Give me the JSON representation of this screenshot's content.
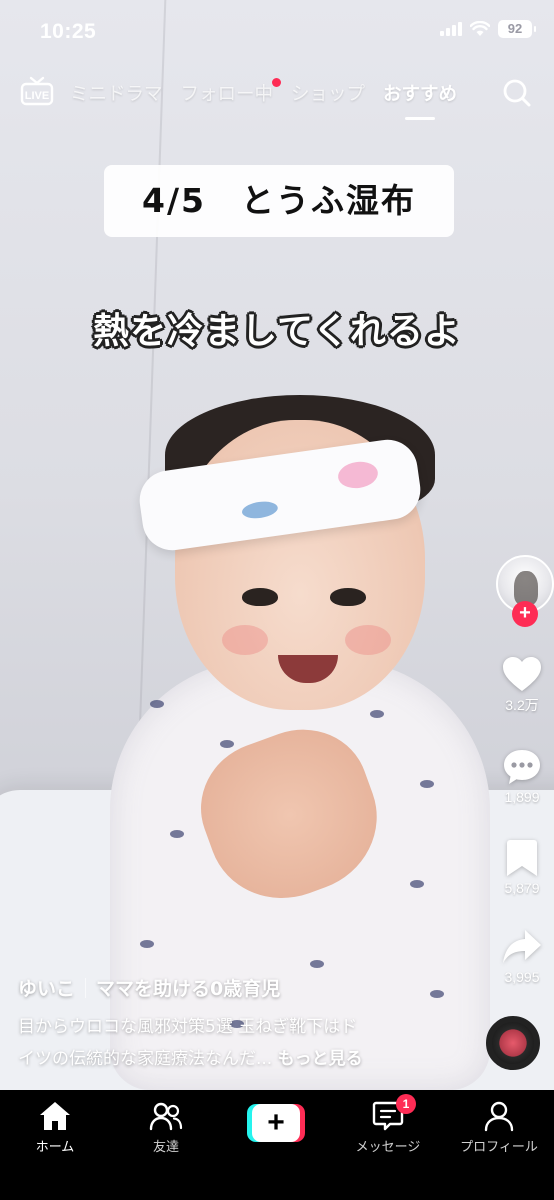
{
  "status_bar": {
    "time": "10:25",
    "battery": "92"
  },
  "top_nav": {
    "live_label": "LIVE",
    "tabs": [
      {
        "label": "ミニドラマ",
        "active": false
      },
      {
        "label": "フォロー中",
        "active": false,
        "has_dot": true
      },
      {
        "label": "ショップ",
        "active": false
      },
      {
        "label": "おすすめ",
        "active": true
      }
    ],
    "search_icon": "search-icon"
  },
  "video": {
    "caption_title": "4/5　とうふ湿布",
    "caption_sub": "熱を冷ましてくれるよ"
  },
  "side_actions": {
    "likes": "3.2万",
    "comments": "1,899",
    "saves": "5,879",
    "shares": "3,995"
  },
  "info": {
    "author": "ゆいこ",
    "tagline": "ママを助ける0歳育児",
    "description_line1": "目からウロコな風邪対策5選 玉ねぎ靴下はド",
    "description_line2": "イツの伝統的な家庭療法なんだ...",
    "more_label": "もっと見る"
  },
  "bottom_nav": {
    "home": "ホーム",
    "friends": "友達",
    "create_symbol": "+",
    "inbox": "メッセージ",
    "inbox_badge": "1",
    "profile": "プロフィール"
  },
  "colors": {
    "accent_red": "#fe2c55",
    "accent_cyan": "#25f4ee",
    "nav_background": "#000000"
  }
}
